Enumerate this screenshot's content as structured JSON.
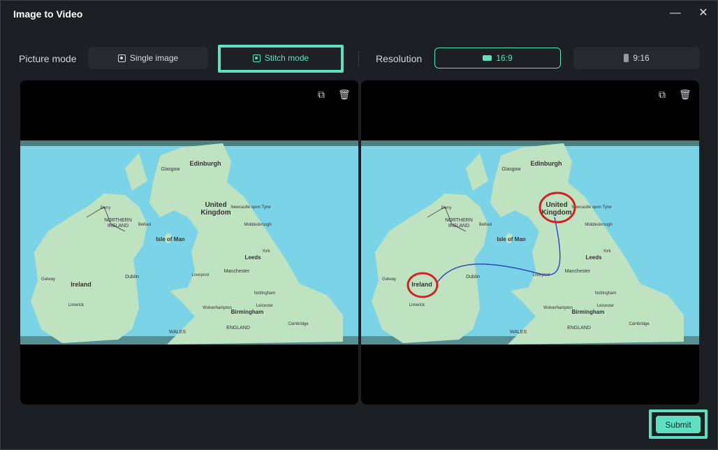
{
  "window": {
    "title": "Image to Video",
    "minimize_icon": "minimize-icon",
    "close_icon": "close-icon"
  },
  "picture_mode": {
    "label": "Picture mode",
    "options": [
      {
        "label": "Single image",
        "icon": "image-icon",
        "selected": false
      },
      {
        "label": "Stitch mode",
        "icon": "image-icon",
        "selected": true
      }
    ]
  },
  "resolution": {
    "label": "Resolution",
    "options": [
      {
        "label": "16:9",
        "icon": "landscape-icon",
        "selected": true
      },
      {
        "label": "9:16",
        "icon": "portrait-icon",
        "selected": false
      }
    ]
  },
  "map_labels": [
    "Edinburgh",
    "Glasgow",
    "United Kingdom",
    "NORTHERN IRELAND",
    "Belfast",
    "Derry",
    "Isle of Man",
    "Ireland",
    "Dublin",
    "Liverpool",
    "Manchester",
    "Leeds",
    "York",
    "Newcastle upon Tyne",
    "Middlesbrough",
    "Birmingham",
    "Nottingham",
    "Leicester",
    "Cambridge",
    "Wolverhampton",
    "WALES",
    "ENGLAND",
    "Limerick",
    "Galway"
  ],
  "colors": {
    "accent": "#5fe0c1",
    "sea": "#7ad3e6",
    "land": "#bfe3c0",
    "route": "#3346c8",
    "circle": "#d42020"
  },
  "submit_label": "Submit"
}
